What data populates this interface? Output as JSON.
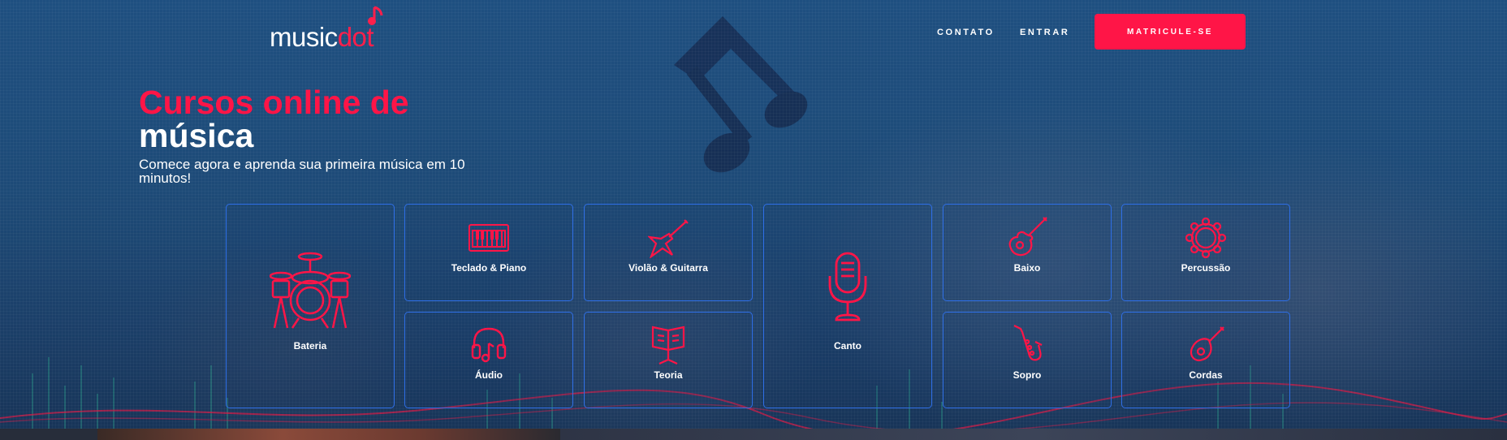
{
  "brand": {
    "logo_part1": "music",
    "logo_part2": "dot",
    "accent": "#ff1547",
    "card_border": "#2f6fe6",
    "background": "#1c4a78"
  },
  "nav": {
    "contato": "CONTATO",
    "entrar": "ENTRAR",
    "cta": "MATRICULE-SE"
  },
  "hero": {
    "title_line1": "Cursos online de",
    "title_line2": "música",
    "subtitle": "Comece agora e aprenda sua primeira música em 10 minutos!"
  },
  "courses": [
    {
      "label": "Bateria",
      "icon": "drum-kit-icon"
    },
    {
      "label": "Teclado & Piano",
      "icon": "keyboard-icon"
    },
    {
      "label": "Violão & Guitarra",
      "icon": "electric-guitar-icon"
    },
    {
      "label": "Canto",
      "icon": "microphone-icon"
    },
    {
      "label": "Baixo",
      "icon": "bass-guitar-icon"
    },
    {
      "label": "Percussão",
      "icon": "tambourine-icon"
    },
    {
      "label": "Áudio",
      "icon": "headphones-icon"
    },
    {
      "label": "Teoria",
      "icon": "music-stand-icon"
    },
    {
      "label": "Sopro",
      "icon": "saxophone-icon"
    },
    {
      "label": "Cordas",
      "icon": "mandolin-icon"
    }
  ]
}
